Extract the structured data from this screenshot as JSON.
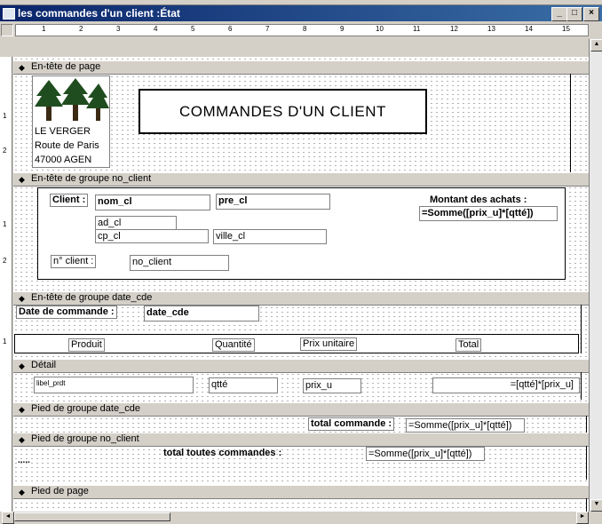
{
  "window": {
    "title": "les commandes d'un client :État",
    "buttons": [
      "_",
      "□",
      "×"
    ]
  },
  "ruler": {
    "ticks": [
      "1",
      "2",
      "3",
      "4",
      "5",
      "6",
      "7",
      "8",
      "9",
      "10",
      "11",
      "12",
      "13",
      "14",
      "15"
    ]
  },
  "vruler_marks": {
    "page_header": [
      "1",
      "2"
    ],
    "group_client": [
      "1",
      "2"
    ],
    "group_date": [
      "1"
    ]
  },
  "sections": {
    "page_header": "En-tête de page",
    "group_header_client": "En-tête de groupe no_client",
    "group_header_date": "En-tête de groupe date_cde",
    "detail": "Détail",
    "group_footer_date": "Pied de groupe date_cde",
    "group_footer_client": "Pied de groupe no_client",
    "page_footer": "Pied de page"
  },
  "page_header": {
    "company_line1": "LE VERGER",
    "company_line2": "Route de Paris",
    "company_line3": "47000 AGEN",
    "title": "COMMANDES D'UN CLIENT"
  },
  "group_client": {
    "client_label": "Client :",
    "nom_cl": "nom_cl",
    "pre_cl": "pre_cl",
    "ad_cl": "ad_cl",
    "cp_cl": "cp_cl",
    "ville_cl": "ville_cl",
    "no_client_label": "n° client :",
    "no_client": "no_client",
    "montant_label": "Montant des achats :",
    "montant_expr": "=Somme([prix_u]*[qtté])"
  },
  "group_date": {
    "date_label": "Date de commande :",
    "date_cde": "date_cde",
    "col_produit": "Produit",
    "col_quantite": "Quantité",
    "col_prix": "Prix unitaire",
    "col_total": "Total"
  },
  "detail": {
    "libel": "libel_prdt",
    "qtte": "qtté",
    "prix_u": "prix_u",
    "total_expr": "=[qtté]*[prix_u]"
  },
  "footer_date": {
    "label": "total commande :",
    "expr": "=Somme([prix_u]*[qtté])"
  },
  "footer_client": {
    "label": "total toutes commandes :",
    "expr": "=Somme([prix_u]*[qtté])"
  }
}
